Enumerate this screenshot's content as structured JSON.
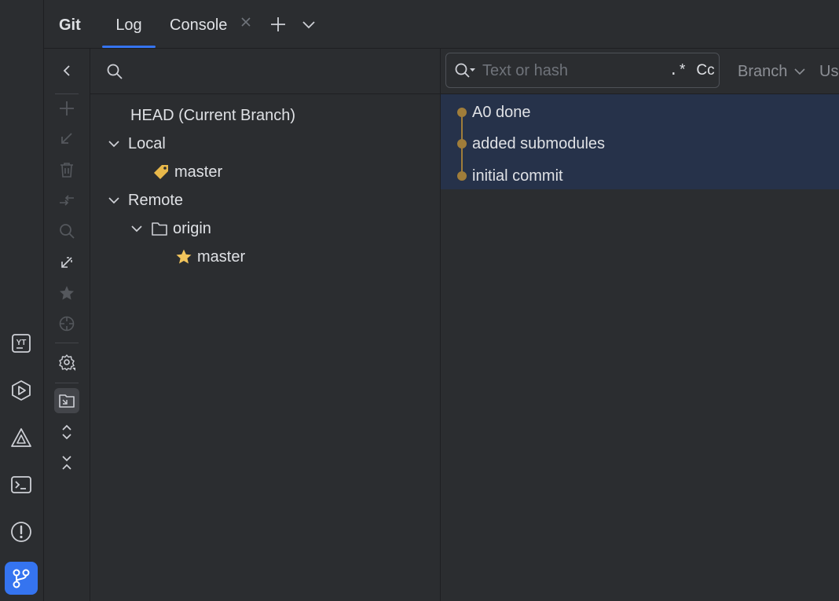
{
  "colors": {
    "background": "#2b2d30",
    "accent": "#3574f0",
    "selection": "#26324a",
    "graph": "#a07d3a",
    "star": "#f2c55c",
    "tag": "#e8b84a"
  },
  "left_toolbar": {
    "items": [
      {
        "name": "youtrack",
        "label": "YT"
      },
      {
        "name": "run-services",
        "icon": "play-hex-icon"
      },
      {
        "name": "problems-triangle",
        "icon": "triangle-icon"
      },
      {
        "name": "terminal",
        "icon": "terminal-icon"
      },
      {
        "name": "problems",
        "icon": "exclamation-circle-icon"
      },
      {
        "name": "git",
        "icon": "branch-icon",
        "active": true
      }
    ]
  },
  "tabbar": {
    "title": "Git",
    "tabs": [
      {
        "label": "Log",
        "active": true
      },
      {
        "label": "Console",
        "closable": true
      }
    ]
  },
  "branch_toolbar": {
    "icons": [
      "collapse-left-icon",
      "add-icon",
      "update-icon",
      "delete-icon",
      "compare-icon",
      "search-icon",
      "fetch-icon",
      "star-icon",
      "target-icon",
      "settings-icon",
      "group-by-directory-icon",
      "expand-all-icon",
      "collapse-all-icon"
    ],
    "selected": "group-by-directory-icon"
  },
  "branches": {
    "head_label": "HEAD (Current Branch)",
    "local_label": "Local",
    "local_branches": [
      "master"
    ],
    "remote_label": "Remote",
    "remote_group": "origin",
    "remote_branches": [
      "master"
    ]
  },
  "log": {
    "filter_placeholder": "Text or hash",
    "regex_label": ".*",
    "case_label": "Cc",
    "branch_filter": "Branch",
    "user_filter": "Us",
    "commits": [
      {
        "message": "A0 done"
      },
      {
        "message": "added submodules"
      },
      {
        "message": "initial commit"
      }
    ]
  }
}
